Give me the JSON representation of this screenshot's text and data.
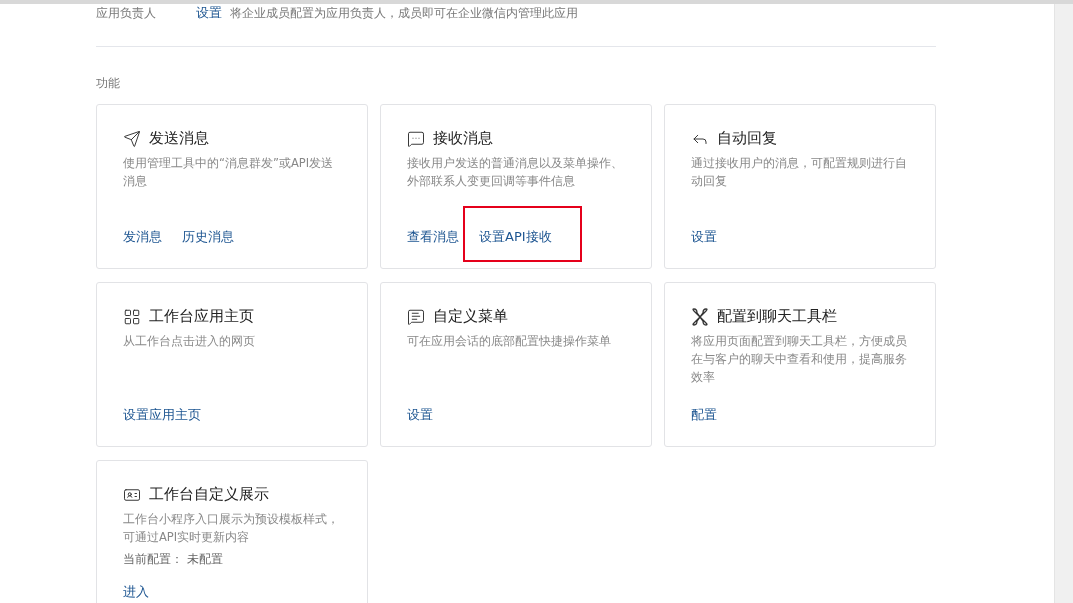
{
  "owner_row": {
    "label": "应用负责人",
    "link": "设置",
    "description": "将企业成员配置为应用负责人，成员即可在企业微信内管理此应用"
  },
  "section_title": "功能",
  "cards": [
    {
      "kind": "send",
      "title": "发送消息",
      "description": "使用管理工具中的“消息群发”或API发送消息",
      "links": [
        {
          "label": "发消息",
          "highlighted": false
        },
        {
          "label": "历史消息",
          "highlighted": false
        }
      ]
    },
    {
      "kind": "chat",
      "title": "接收消息",
      "description": "接收用户发送的普通消息以及菜单操作、外部联系人变更回调等事件信息",
      "links": [
        {
          "label": "查看消息",
          "highlighted": false
        },
        {
          "label": "设置API接收",
          "highlighted": true
        }
      ]
    },
    {
      "kind": "reply",
      "title": "自动回复",
      "description": "通过接收用户的消息，可配置规则进行自动回复",
      "links": [
        {
          "label": "设置",
          "highlighted": false
        }
      ]
    },
    {
      "kind": "grid",
      "title": "工作台应用主页",
      "description": "从工作台点击进入的网页",
      "links": [
        {
          "label": "设置应用主页",
          "highlighted": false
        }
      ]
    },
    {
      "kind": "menu",
      "title": "自定义菜单",
      "description": "可在应用会话的底部配置快捷操作菜单",
      "links": [
        {
          "label": "设置",
          "highlighted": false
        }
      ]
    },
    {
      "kind": "petals",
      "title": "配置到聊天工具栏",
      "description": "将应用页面配置到聊天工具栏，方便成员在与客户的聊天中查看和使用，提高服务效率",
      "links": [
        {
          "label": "配置",
          "highlighted": false
        }
      ]
    },
    {
      "kind": "card",
      "title": "工作台自定义展示",
      "description": "工作台小程序入口展示为预设模板样式，可通过API实时更新内容",
      "status": "当前配置： 未配置",
      "links": [
        {
          "label": "进入",
          "highlighted": false
        }
      ]
    }
  ]
}
